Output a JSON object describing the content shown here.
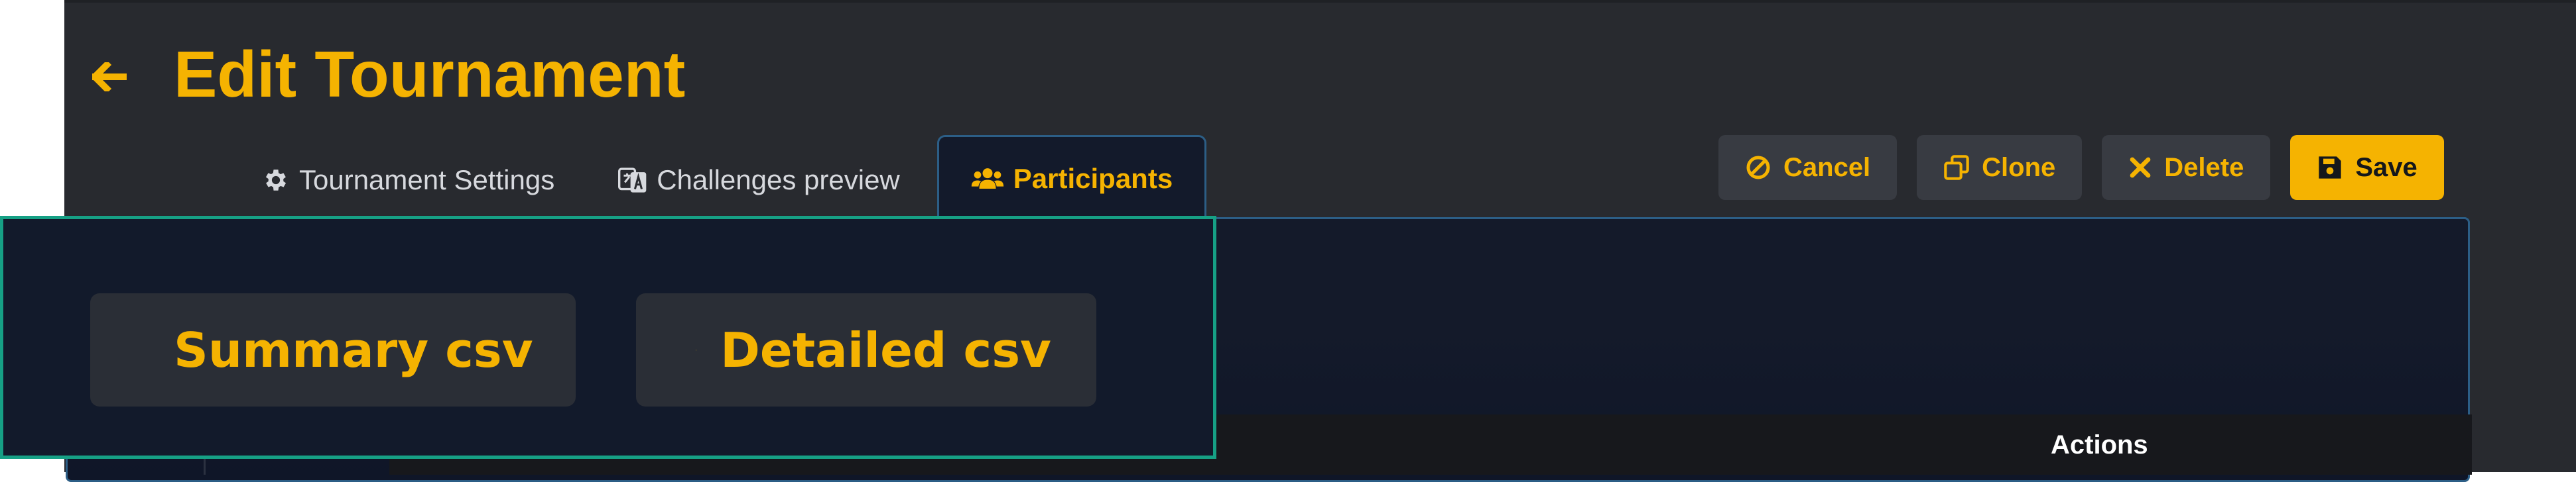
{
  "header": {
    "title": "Edit Tournament"
  },
  "tabs": [
    {
      "label": "Tournament Settings",
      "icon": "gear-icon",
      "active": false
    },
    {
      "label": "Challenges preview",
      "icon": "translate-icon",
      "active": false
    },
    {
      "label": "Participants",
      "icon": "users-icon",
      "active": true
    }
  ],
  "toolbar": {
    "cancel_label": "Cancel",
    "clone_label": "Clone",
    "delete_label": "Delete",
    "save_label": "Save"
  },
  "table": {
    "columns": [
      "Actions"
    ]
  },
  "export": {
    "summary_label": "Summary csv",
    "detailed_label": "Detailed csv"
  },
  "colors": {
    "accent": "#f5b301",
    "background": "#282a2f",
    "panel": "#141a2a",
    "highlight_border": "#16a085",
    "tab_border": "#2c5e86"
  }
}
